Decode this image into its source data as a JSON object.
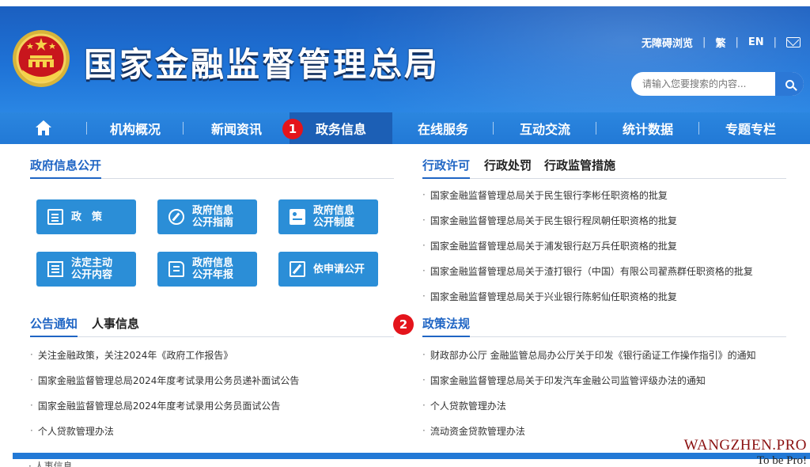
{
  "header": {
    "site_title": "国家金融监督管理总局",
    "accessible_link": "无障碍浏览",
    "traditional_link": "繁",
    "english_link": "EN",
    "search_placeholder": "请输入您要搜索的内容..."
  },
  "nav": {
    "items": [
      "机构概况",
      "新闻资讯",
      "政务信息",
      "在线服务",
      "互动交流",
      "统计数据",
      "专题专栏"
    ],
    "active_index": 2
  },
  "markers": [
    "1",
    "2"
  ],
  "gov_info": {
    "tab": "政府信息公开",
    "tiles": [
      "政　策",
      "政府信息\n公开指南",
      "政府信息\n公开制度",
      "法定主动\n公开内容",
      "政府信息\n公开年报",
      "依申请公开"
    ]
  },
  "admin": {
    "tabs": [
      "行政许可",
      "行政处罚",
      "行政监管措施"
    ],
    "items": [
      "国家金融监督管理总局关于民生银行李彬任职资格的批复",
      "国家金融监督管理总局关于民生银行程凤朝任职资格的批复",
      "国家金融监督管理总局关于浦发银行赵万兵任职资格的批复",
      "国家金融监督管理总局关于渣打银行（中国）有限公司翟燕群任职资格的批复",
      "国家金融监督管理总局关于兴业银行陈躬仙任职资格的批复"
    ]
  },
  "notice": {
    "tabs": [
      "公告通知",
      "人事信息"
    ],
    "items": [
      "关注金融政策，关注2024年《政府工作报告》",
      "国家金融监督管理总局2024年度考试录用公务员递补面试公告",
      "国家金融监督管理总局2024年度考试录用公务员面试公告",
      "个人贷款管理办法"
    ]
  },
  "policy": {
    "tab": "政策法规",
    "items": [
      "财政部办公厅 金融监管总局办公厅关于印发《银行函证工作操作指引》的通知",
      "国家金融监督管理总局关于印发汽车金融公司监管评级办法的通知",
      "个人贷款管理办法",
      "流动资金贷款管理办法"
    ]
  },
  "bottom_peek": "人事信息",
  "watermark": {
    "line1": "WANGZHEN.PRO",
    "line2": "To be Pro!"
  },
  "colors": {
    "brand_blue": "#1f65c4",
    "nav_blue": "#2279d6",
    "tile_blue": "#2b8ed7",
    "marker_red": "#e4141b"
  },
  "icons": [
    "national-emblem",
    "mail-icon",
    "search-icon",
    "home-icon",
    "document-icon",
    "compass-icon",
    "id-card-icon",
    "list-icon",
    "book-icon",
    "edit-icon"
  ]
}
